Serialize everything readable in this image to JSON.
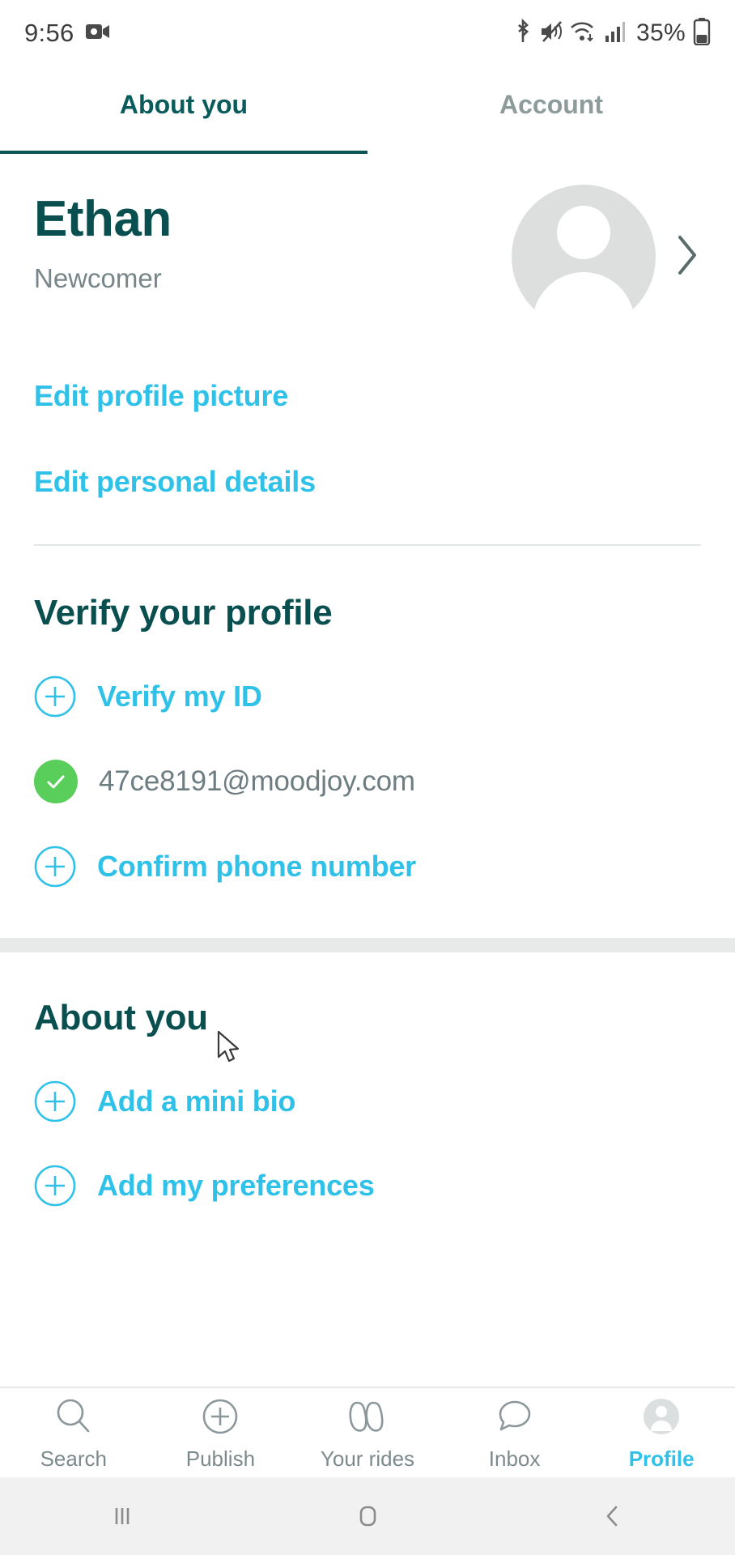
{
  "status_bar": {
    "time": "9:56",
    "battery_percent": "35%",
    "icons": [
      "video-camera-icon",
      "bluetooth-icon",
      "mute-icon",
      "wifi-icon",
      "cellular-signal-icon",
      "battery-icon"
    ]
  },
  "tabs": [
    {
      "label": "About you",
      "active": true
    },
    {
      "label": "Account",
      "active": false
    }
  ],
  "profile": {
    "name": "Ethan",
    "status": "Newcomer",
    "avatar_alt": "avatar",
    "chevron": "›"
  },
  "links": [
    {
      "label": "Edit profile picture"
    },
    {
      "label": "Edit personal details"
    }
  ],
  "verify_section": {
    "heading": "Verify your profile",
    "items": [
      {
        "label": "Verify my ID",
        "icon": "plus-circle-icon",
        "verified": false
      },
      {
        "label": "47ce8191@moodjoy.com",
        "icon": "check-circle-icon",
        "verified": true
      },
      {
        "label": "Confirm phone number",
        "icon": "plus-circle-icon",
        "verified": false
      }
    ]
  },
  "about_section": {
    "heading": "About you",
    "items": [
      {
        "label": "Add a mini bio",
        "icon": "plus-circle-icon"
      },
      {
        "label": "Add my preferences",
        "icon": "plus-circle-icon"
      }
    ]
  },
  "bottom_nav": [
    {
      "label": "Search",
      "icon": "search-icon",
      "active": false
    },
    {
      "label": "Publish",
      "icon": "plus-circle-icon",
      "active": false
    },
    {
      "label": "Your rides",
      "icon": "rides-icon",
      "active": false
    },
    {
      "label": "Inbox",
      "icon": "chat-icon",
      "active": false
    },
    {
      "label": "Profile",
      "icon": "avatar-icon",
      "active": true
    }
  ],
  "system_nav": [
    {
      "name": "recents-button",
      "glyph": "|||"
    },
    {
      "name": "home-button",
      "glyph": "▢"
    },
    {
      "name": "back-button",
      "glyph": "‹"
    }
  ],
  "colors": {
    "accent_cyan": "#2fc1e8",
    "dark_teal": "#0a4f4f",
    "verified_green": "#5ace5a",
    "muted_gray": "#78868a"
  }
}
